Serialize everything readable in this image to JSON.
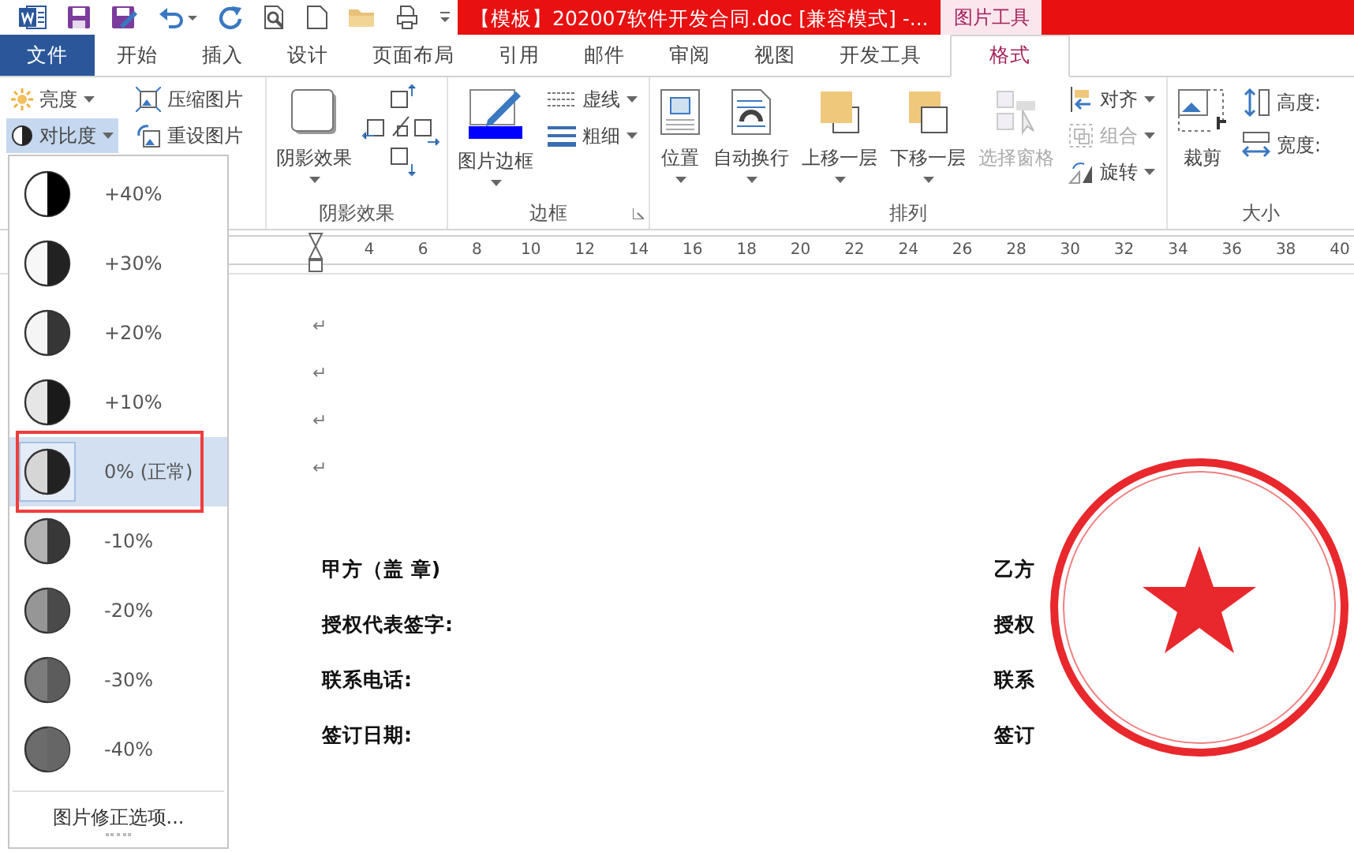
{
  "title": "【模板】202007软件开发合同.doc [兼容模式] -...",
  "context_tab": "图片工具",
  "tabs": [
    {
      "label": "文件",
      "kind": "file",
      "selected": false
    },
    {
      "label": "开始",
      "kind": "normal",
      "selected": false
    },
    {
      "label": "插入",
      "kind": "normal",
      "selected": false
    },
    {
      "label": "设计",
      "kind": "normal",
      "selected": false
    },
    {
      "label": "页面布局",
      "kind": "normal",
      "selected": false
    },
    {
      "label": "引用",
      "kind": "normal",
      "selected": false
    },
    {
      "label": "邮件",
      "kind": "normal",
      "selected": false
    },
    {
      "label": "审阅",
      "kind": "normal",
      "selected": false
    },
    {
      "label": "视图",
      "kind": "normal",
      "selected": false
    },
    {
      "label": "开发工具",
      "kind": "normal",
      "selected": false
    },
    {
      "label": "格式",
      "kind": "context",
      "selected": true
    }
  ],
  "ribbon": {
    "adjust": {
      "dropdowns": [
        {
          "label": "亮度",
          "kind": "brightness",
          "pressed": false
        },
        {
          "label": "对比度",
          "kind": "contrast",
          "pressed": true
        }
      ],
      "tools": [
        {
          "label": "压缩图片",
          "kind": "compress"
        },
        {
          "label": "重设图片",
          "kind": "reset"
        }
      ]
    },
    "shadow": {
      "button": "阴影效果",
      "label": "阴影效果"
    },
    "border": {
      "button": "图片边框",
      "small": [
        {
          "label": "虚线",
          "kind": "dash"
        },
        {
          "label": "粗细",
          "kind": "weight"
        }
      ],
      "label": "边框"
    },
    "arrange": {
      "buttons": [
        {
          "label": "位置",
          "kind": "position",
          "disabled": false
        },
        {
          "label": "自动换行",
          "kind": "wrap",
          "disabled": false
        },
        {
          "label": "上移一层",
          "kind": "forward",
          "disabled": false
        },
        {
          "label": "下移一层",
          "kind": "backward",
          "disabled": false
        },
        {
          "label": "选择窗格",
          "kind": "pane",
          "disabled": true
        }
      ],
      "small": [
        {
          "label": "对齐",
          "kind": "align",
          "disabled": false
        },
        {
          "label": "组合",
          "kind": "group",
          "disabled": true
        },
        {
          "label": "旋转",
          "kind": "rotate",
          "disabled": false
        }
      ],
      "label": "排列"
    },
    "size": {
      "button": "裁剪",
      "fields": [
        {
          "label": "高度:",
          "kind": "height"
        },
        {
          "label": "宽度:",
          "kind": "width"
        }
      ],
      "label": "大小"
    }
  },
  "contrast_menu": {
    "items": [
      {
        "label": "+40%",
        "selected": false,
        "highlighted": false
      },
      {
        "label": "+30%",
        "selected": false,
        "highlighted": false
      },
      {
        "label": "+20%",
        "selected": false,
        "highlighted": false
      },
      {
        "label": "+10%",
        "selected": false,
        "highlighted": false
      },
      {
        "label": "0% (正常)",
        "selected": true,
        "highlighted": true
      },
      {
        "label": "-10%",
        "selected": false,
        "highlighted": false
      },
      {
        "label": "-20%",
        "selected": false,
        "highlighted": false
      },
      {
        "label": "-30%",
        "selected": false,
        "highlighted": false
      },
      {
        "label": "-40%",
        "selected": false,
        "highlighted": false
      }
    ],
    "footer": "图片修正选项..."
  },
  "ruler": [
    "4",
    "6",
    "8",
    "10",
    "12",
    "14",
    "16",
    "18",
    "20",
    "22",
    "24",
    "26",
    "28",
    "30",
    "32",
    "34",
    "36",
    "38",
    "40"
  ],
  "document": {
    "paragraph_marks": [
      "↵",
      "↵",
      "↵",
      "↵"
    ],
    "left_fields": [
      "甲方（盖 章)",
      "授权代表签字:",
      "联系电话:",
      "签订日期:"
    ],
    "right_fields": [
      "乙方",
      "授权",
      "联系",
      "签订"
    ]
  }
}
